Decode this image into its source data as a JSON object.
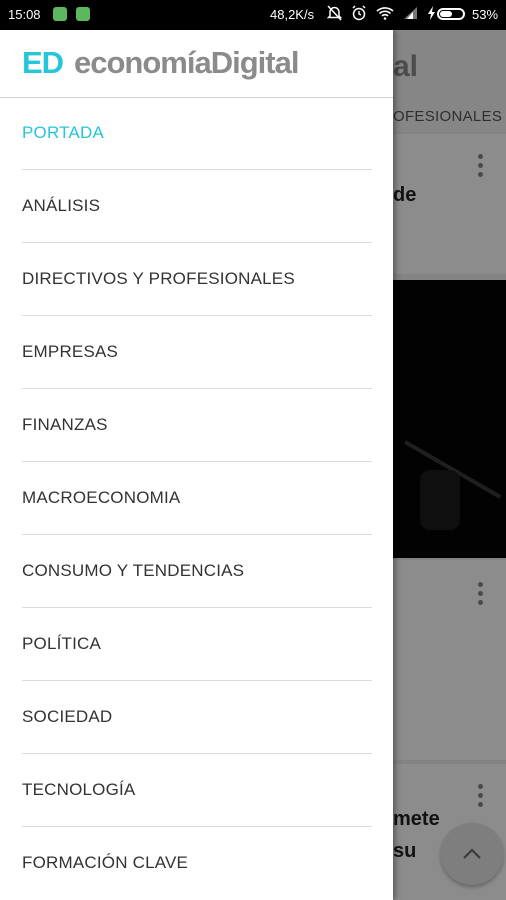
{
  "status_bar": {
    "time": "15:08",
    "network_speed": "48,2K/s",
    "battery_percent": "53%",
    "battery_level": 0.53,
    "icons": [
      "notification-icon",
      "notification-icon",
      "mute-icon",
      "alarm-icon",
      "wifi-icon",
      "signal-icon",
      "charging-icon",
      "battery-icon"
    ]
  },
  "drawer": {
    "brand_mark": "ED",
    "brand_name": "economíaDigital",
    "accent_color": "#26c6da",
    "items": [
      {
        "label": "PORTADA"
      },
      {
        "label": "ANÁLISIS"
      },
      {
        "label": "DIRECTIVOS Y PROFESIONALES"
      },
      {
        "label": "EMPRESAS"
      },
      {
        "label": "FINANZAS"
      },
      {
        "label": "MACROECONOMIA"
      },
      {
        "label": "CONSUMO Y TENDENCIAS"
      },
      {
        "label": "POLÍTICA"
      },
      {
        "label": "SOCIEDAD"
      },
      {
        "label": "TECNOLOGÍA"
      },
      {
        "label": "FORMACIÓN CLAVE"
      }
    ]
  },
  "background": {
    "logo_fragment": "al",
    "tab_fragment": "OFESIONALES",
    "card1_fragment": "de",
    "card3_fragment_line1": "mete",
    "card3_fragment_line2": "su"
  }
}
